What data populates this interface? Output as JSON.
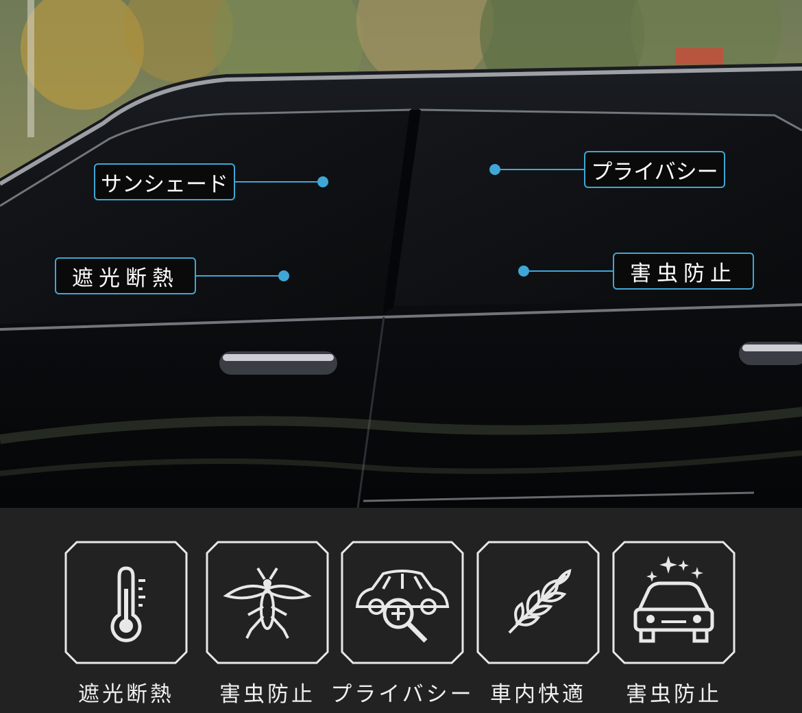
{
  "callouts": {
    "sunshade": "サンシェード",
    "privacy": "プライバシー",
    "light_heat": "遮光断熱",
    "insect": "害虫防止"
  },
  "features": [
    {
      "icon": "thermometer-icon",
      "label": "遮光断熱"
    },
    {
      "icon": "mosquito-icon",
      "label": "害虫防止"
    },
    {
      "icon": "car-privacy-icon",
      "label": "プライバシー"
    },
    {
      "icon": "leaf-icon",
      "label": "車内快適"
    },
    {
      "icon": "sparkling-car-icon",
      "label": "害虫防止"
    }
  ],
  "colors": {
    "accent": "#3fa7d6",
    "panel": "#222222",
    "car": "#0d0f12"
  }
}
